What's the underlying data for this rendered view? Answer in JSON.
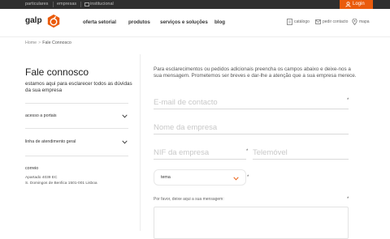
{
  "topbar": {
    "links": [
      "particulares",
      "empresas",
      "institucional"
    ],
    "login_label": "Login"
  },
  "header": {
    "logo_text": "galp",
    "nav": [
      "oferta setorial",
      "produtos",
      "serviços e soluções",
      "blog"
    ],
    "utility": [
      "catálogo",
      "pedir contacto",
      "mapa"
    ]
  },
  "breadcrumb": {
    "home": "Home",
    "separator": ">",
    "current": "Fale Connosco"
  },
  "sidebar": {
    "title": "Fale connosco",
    "subtitle": "estamos aqui para esclarecer todos as dúvidas da sua empresa",
    "accordions": [
      "acesso a portais",
      "linha de atendimento geral"
    ],
    "mail_heading": "correio",
    "address_lines": [
      "Apartado 4039 EC",
      "S. Domingos de Benfica 1501-001 Lisboa"
    ]
  },
  "form": {
    "intro": "Para esclarecimentos ou pedidos adicionais preencha os campos abaixo e deixe-nos a sua mensagem. Prometemos ser breves e dar-lhe a atenção que a sua empresa merece.",
    "email_placeholder": "E-mail de contacto",
    "company_placeholder": "Nome da empresa",
    "nif_placeholder": "NIF da empresa",
    "phone_placeholder": "Telemóvel",
    "required_mark": "*",
    "tema_value": "tema",
    "message_label": "Por favor, deixe aqui a sua mensagem:"
  },
  "colors": {
    "brand_orange": "#ea5b0c",
    "topbar": "#2f2f2f"
  }
}
